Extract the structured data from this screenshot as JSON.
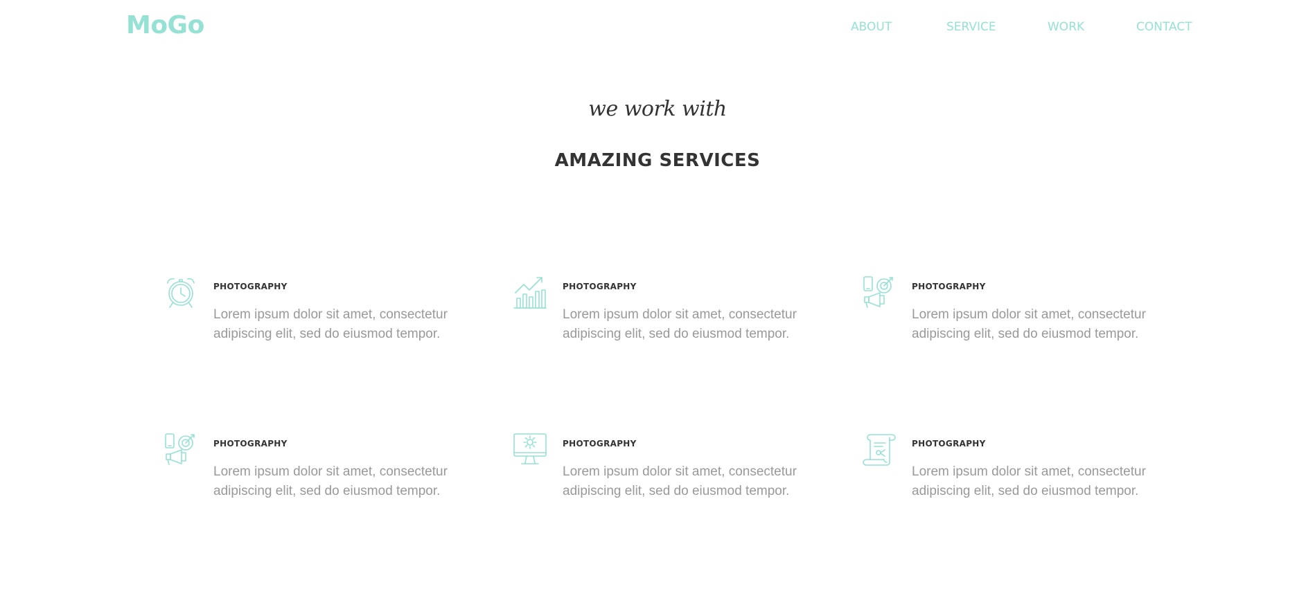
{
  "brand": {
    "logo": "MoGo",
    "accent_color": "#95e1d3"
  },
  "nav": {
    "items": [
      {
        "label": "ABOUT"
      },
      {
        "label": "SERVICE"
      },
      {
        "label": "WORK"
      },
      {
        "label": "CONTACT"
      }
    ]
  },
  "section": {
    "subtitle": "we work with",
    "title": "AMAZING SERVICES"
  },
  "services": [
    {
      "icon": "alarm-clock-icon",
      "title": "PHOTOGRAPHY",
      "text": "Lorem ipsum dolor sit amet, consectetur adipiscing elit, sed do eiusmod tempor."
    },
    {
      "icon": "growth-chart-icon",
      "title": "PHOTOGRAPHY",
      "text": "Lorem ipsum dolor sit amet, consectetur adipiscing elit, sed do eiusmod tempor."
    },
    {
      "icon": "marketing-megaphone-icon",
      "title": "PHOTOGRAPHY",
      "text": "Lorem ipsum dolor sit amet, consectetur adipiscing elit, sed do eiusmod tempor."
    },
    {
      "icon": "marketing-megaphone-icon",
      "title": "PHOTOGRAPHY",
      "text": "Lorem ipsum dolor sit amet, consectetur adipiscing elit, sed do eiusmod tempor."
    },
    {
      "icon": "monitor-gear-icon",
      "title": "PHOTOGRAPHY",
      "text": "Lorem ipsum dolor sit amet, consectetur adipiscing elit, sed do eiusmod tempor."
    },
    {
      "icon": "scroll-document-icon",
      "title": "PHOTOGRAPHY",
      "text": "Lorem ipsum dolor sit amet, consectetur adipiscing elit, sed do eiusmod tempor."
    }
  ]
}
